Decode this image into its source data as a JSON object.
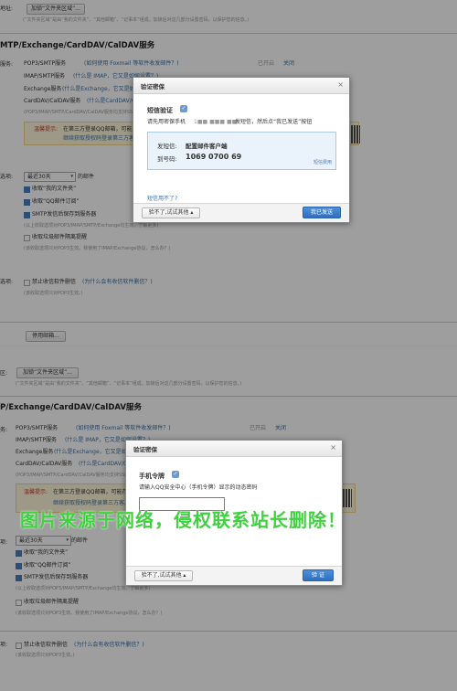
{
  "top": {
    "row_label_addr": "地址:",
    "add_folder_btn": "加锁“文件夹区域”...",
    "folder_hint": "(“文件夹区域”是由“我的文件夹”、“其他邮箱”、“记事本”组成。加锁后对这几部分设置密码，以保护您的信息。)",
    "section_title": "MTP/Exchange/CardDAV/CalDAV服务",
    "row_label_service": "服务:",
    "pop3": "POP3/SMTP服务",
    "pop3_link": "(如何使用 Foxmail 等软件收发邮件？)",
    "pop3_status_label": "已开启",
    "pop3_status": "关闭",
    "imap": "IMAP/SMTP服务",
    "imap_link": "(什么是 IMAP，它又是如何设置？)",
    "exchange": "Exchange服务",
    "exchange_link": "(什么是Exchange，它又是如何设置？)",
    "carddav": "CardDAV/CalDAV服务",
    "carddav_link": "(什么是CardDAV/CalDAV服务？)",
    "proto_hint": "(POP3/IMAP/SMTP/CardDAV/CalDAV服务均支持SSL连接。如何设置？)",
    "warn_label": "温馨提示:",
    "warn_text": "在第三方登录QQ邮箱，可能存在邮件泄露风险，甚至危害Apple ID安全，建议使用QQ邮箱手机版登录。",
    "warn_text2": "继续获取授权码登录第三方客户端",
    "row_label_receive": "选项:",
    "range_select": "最近30天",
    "range_suffix": "的邮件",
    "opt_my_folder": "收取“我的文件夹”",
    "opt_qq_sub": "收取“QQ邮件订阅”",
    "opt_smtp_save": "SMTP发信后保存到服务器",
    "opt_smtp_hint": "(以上收取选项对POP3/IMAP/SMTP/Exchange均生效。了解更多)",
    "opt_spam": "收取垃圾邮件隔离提醒",
    "opt_spam_hint": "(该收取选项只对POP3生效。我使用了IMAP/Exchange协议，怎么办？)",
    "row_label_delete": "选项:",
    "opt_delete": "禁止收信软件删信",
    "opt_delete_link": "(为什么会有收信软件删信？)",
    "opt_delete_hint": "(该收取选项只对POP3生效。)",
    "disable_btn": "停用邮箱..."
  },
  "dialog1": {
    "title": "验证密保",
    "heading": "短信验证",
    "desc": "请先用密保手机",
    "desc_masked": "1■■ ■■■ ■■",
    "desc_tail": "发短信，然后点“我已发送”按钮",
    "send_label": "发短信:",
    "send_value": "配置邮件客户端",
    "to_label": "到号码:",
    "to_value": "1069 0700 69",
    "fee": "短信费用",
    "cant_send": "短信用不了?",
    "other_btn": "验不了,试试其他",
    "confirm_btn": "我已发送"
  },
  "bottom": {
    "row_label_addr": "区:",
    "add_folder_btn": "加锁“文件夹区域”...",
    "folder_hint": "(“文件夹区域”是由“我的文件夹”、“其他邮箱”、“记事本”组成。加锁后对这几部分设置密码，以保护您的信息。)",
    "section_title": "P/Exchange/CardDAV/CalDAV服务",
    "row_label_service": "务:",
    "pop3": "POP3/SMTP服务",
    "pop3_link": "(如何使用 Foxmail 等软件收发邮件？)",
    "pop3_status_label": "已开启",
    "pop3_status": "关闭",
    "imap": "IMAP/SMTP服务",
    "imap_link": "(什么是 IMAP，它又是如何设置？)",
    "exchange": "Exchange服务",
    "exchange_link": "(什么是Exchange，它又是如何设置？)",
    "carddav": "CardDAV/CalDAV服务",
    "carddav_link": "(什么是CardDAV/CalDAV服务？)",
    "proto_hint": "(POP3/IMAP/SMTP/CardDAV/CalDAV服务均支持SSL连接。)",
    "warn_label": "温馨提示:",
    "warn_text": "在第三方登录QQ邮箱，可能存在邮件泄露风险，建议使用QQ邮箱手机版登录。",
    "warn_text2": "继续获取授权码登录第三方客户端",
    "row_label_receive": "项:",
    "range_select": "最近30天",
    "range_suffix": "的邮件",
    "opt_my_folder": "收取“我的文件夹”",
    "opt_qq_sub": "收取“QQ邮件订阅”",
    "opt_smtp_save": "SMTP发信后保存到服务器",
    "opt_smtp_hint": "(以上收取选项对POP3/IMAP/SMTP/Exchange均生效。了解更多)",
    "opt_spam": "收取垃圾邮件隔离提醒",
    "opt_spam_hint": "(该收取选项只对POP3生效。我使用了IMAP/Exchange协议，怎么办？)",
    "row_label_delete": "项:",
    "opt_delete": "禁止收信软件删信",
    "opt_delete_link": "(为什么会有收信软件删信？)",
    "opt_delete_hint": "(该收取选项只对POP3生效。)"
  },
  "dialog2": {
    "title": "验证密保",
    "heading": "手机令牌",
    "desc": "请输入QQ安全中心（手机令牌）显示的动态密码",
    "input_value": "",
    "other_btn": "验不了,试试其他",
    "confirm_btn": "验 证"
  },
  "watermark": "图片来源于网络，侵权联系站长删除！"
}
